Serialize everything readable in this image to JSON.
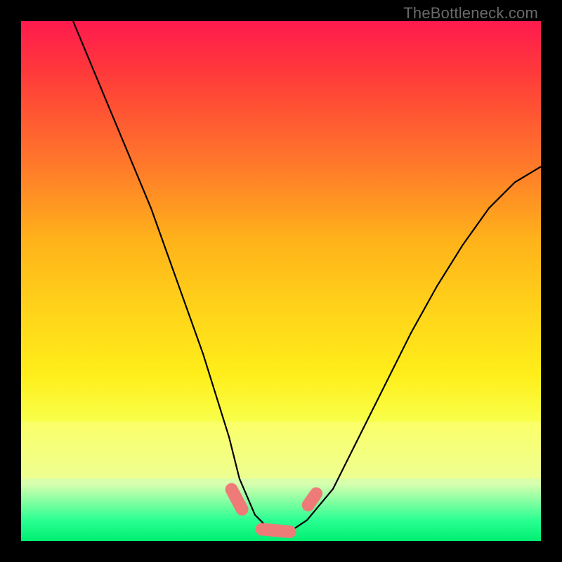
{
  "watermark": "TheBottleneck.com",
  "chart_data": {
    "type": "line",
    "title": "",
    "xlabel": "",
    "ylabel": "",
    "xlim": [
      0,
      100
    ],
    "ylim": [
      0,
      100
    ],
    "grid": false,
    "legend": false,
    "series": [
      {
        "name": "bottleneck-curve",
        "x": [
          10,
          15,
          20,
          25,
          30,
          35,
          40,
          42,
          45,
          48,
          50,
          52,
          55,
          60,
          65,
          70,
          75,
          80,
          85,
          90,
          95,
          100
        ],
        "y": [
          100,
          88,
          76,
          64,
          50,
          36,
          20,
          12,
          5,
          2,
          2,
          2,
          4,
          10,
          20,
          30,
          40,
          49,
          57,
          64,
          69,
          72
        ]
      }
    ],
    "markers": [
      {
        "name": "left-shoulder",
        "x": 41.5,
        "y": 8,
        "shape": "pill-diag-down"
      },
      {
        "name": "valley-floor",
        "x": 49,
        "y": 2,
        "shape": "pill-horiz"
      },
      {
        "name": "right-shoulder",
        "x": 56,
        "y": 8,
        "shape": "pill-diag-up"
      }
    ],
    "colors": {
      "curve": "#000000",
      "marker": "#ef7b78",
      "gradient_top": "#ff1a4e",
      "gradient_bottom": "#00ef72",
      "background_frame": "#000000"
    }
  }
}
